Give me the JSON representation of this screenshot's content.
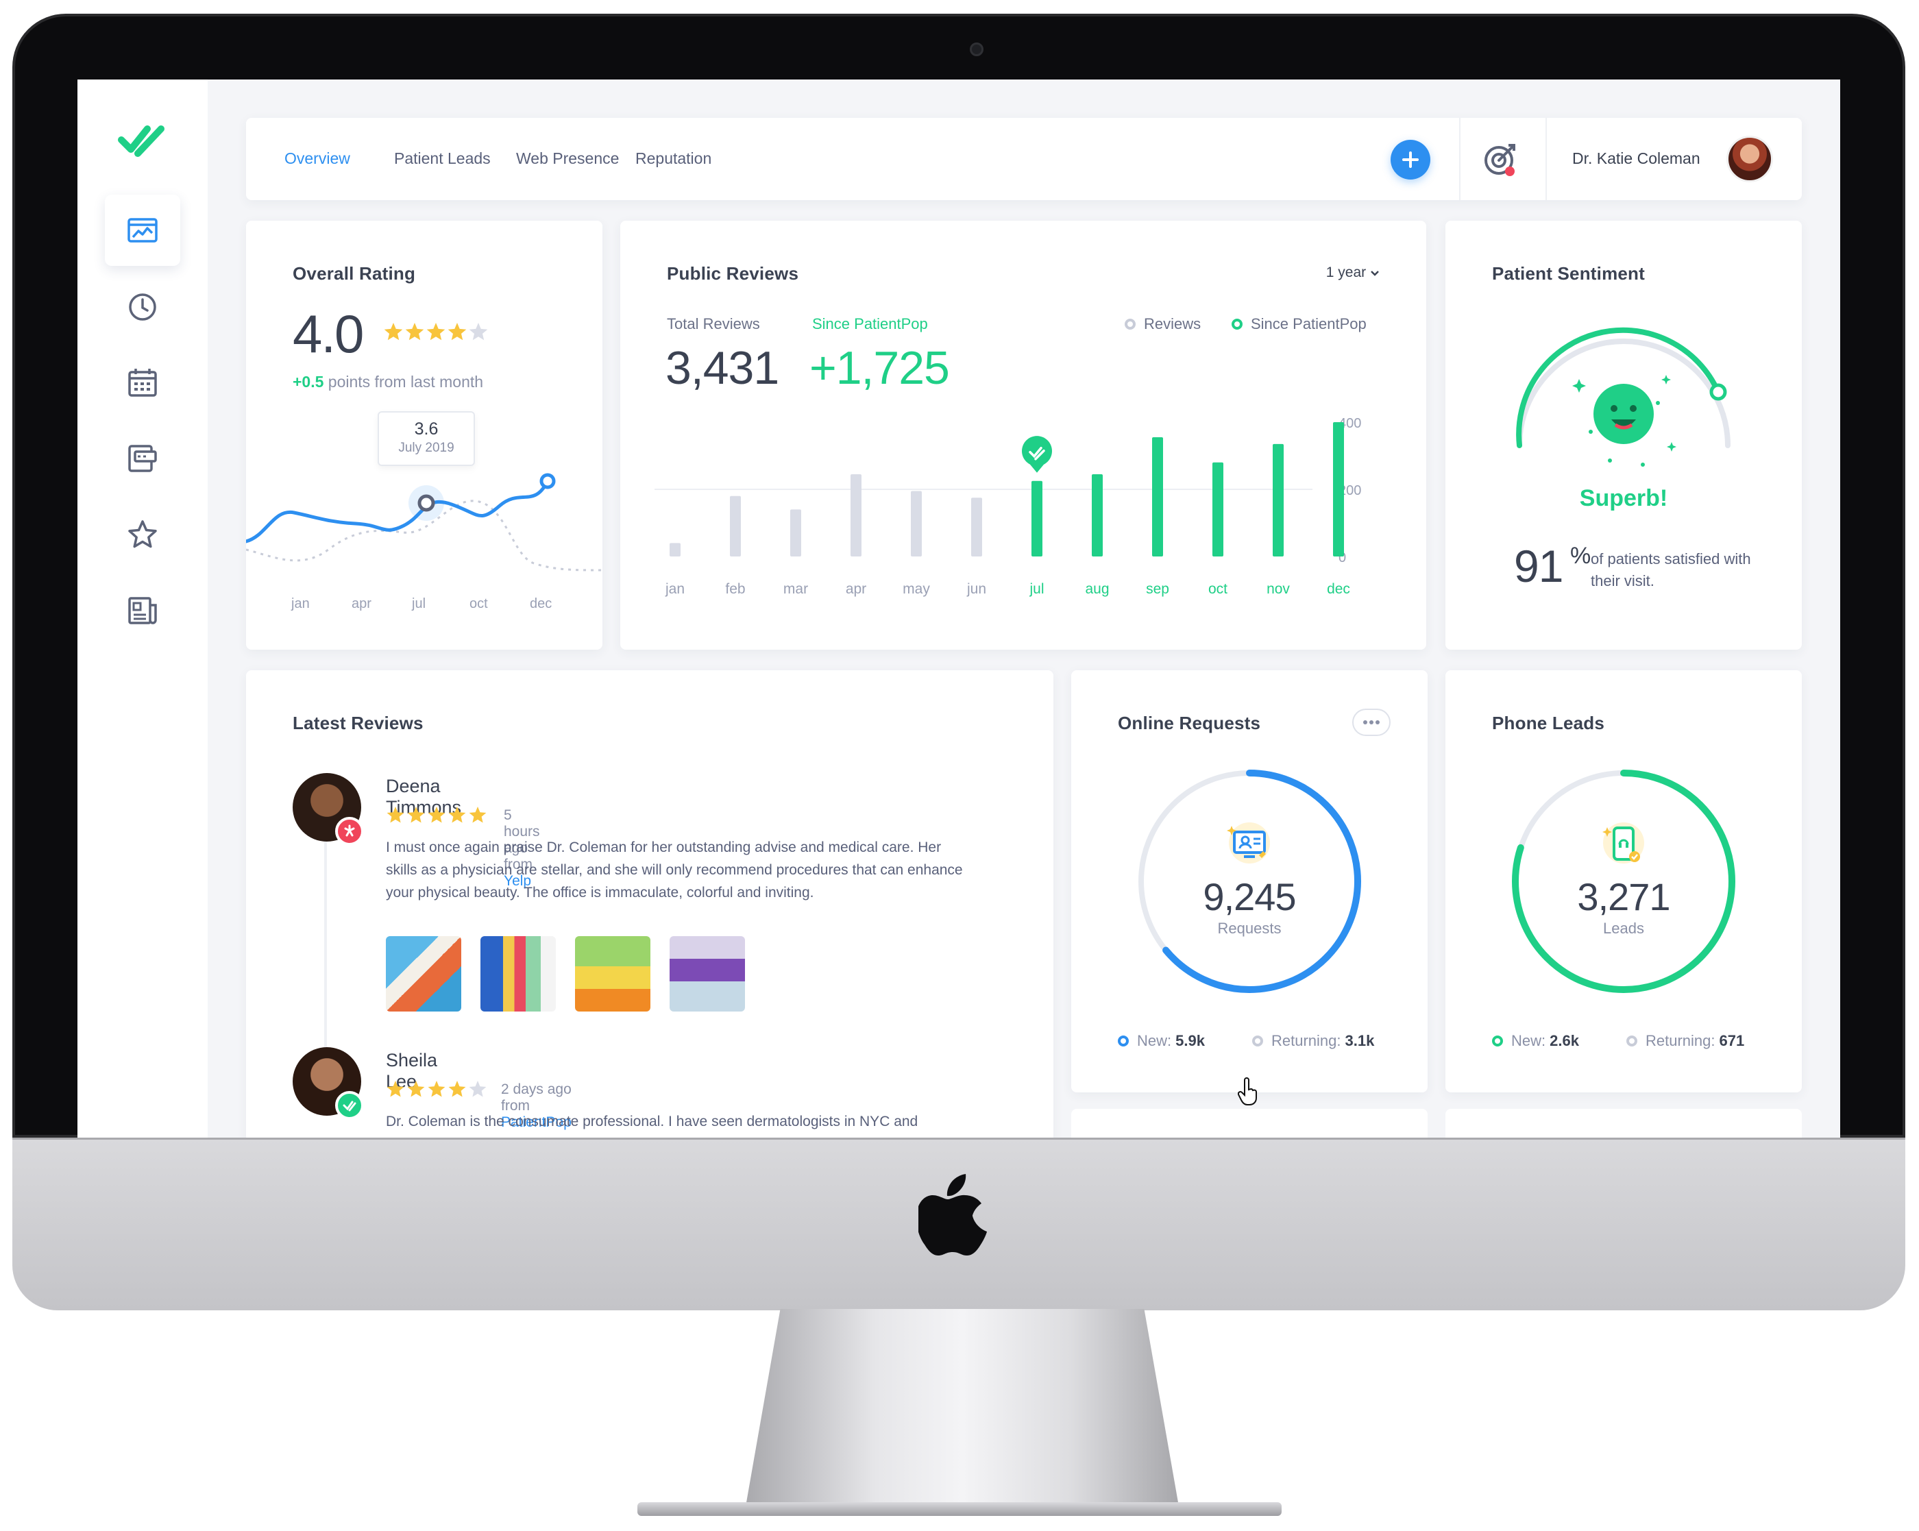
{
  "nav": {
    "tabs": [
      "Overview",
      "Patient Leads",
      "Web Presence",
      "Reputation"
    ],
    "active_tab": "Overview",
    "user_name": "Dr. Katie Coleman"
  },
  "sidebar": {
    "items": [
      "dashboard-icon",
      "clock-icon",
      "calendar-icon",
      "billing-icon",
      "star-icon",
      "news-icon"
    ],
    "active": "dashboard-icon"
  },
  "overall_rating": {
    "title": "Overall Rating",
    "value": "4.0",
    "stars": 4,
    "delta": "+0.5",
    "delta_text": "points from last month",
    "tooltip_value": "3.6",
    "tooltip_date": "July 2019",
    "months": [
      "jan",
      "apr",
      "jul",
      "oct",
      "dec"
    ]
  },
  "public_reviews": {
    "title": "Public Reviews",
    "period": "1 year",
    "total_label": "Total Reviews",
    "total_value": "3,431",
    "since_label": "Since PatientPop",
    "since_value": "+1,725",
    "legend_reviews": "Reviews",
    "legend_since": "Since PatientPop"
  },
  "chart_data": {
    "type": "bar",
    "categories": [
      "jan",
      "feb",
      "mar",
      "apr",
      "may",
      "jun",
      "jul",
      "aug",
      "sep",
      "oct",
      "nov",
      "dec"
    ],
    "series": [
      {
        "name": "Reviews",
        "values": [
          40,
          180,
          140,
          245,
          195,
          175,
          null,
          null,
          null,
          null,
          null,
          null
        ]
      },
      {
        "name": "Since PatientPop",
        "values": [
          null,
          null,
          null,
          null,
          null,
          null,
          225,
          245,
          355,
          280,
          335,
          400
        ]
      }
    ],
    "yticks": [
      0,
      200,
      400
    ],
    "ylim": [
      0,
      400
    ],
    "colors": {
      "Reviews": "#d9dce6",
      "Since PatientPop": "#1fcf87"
    }
  },
  "patient_sentiment": {
    "title": "Patient Sentiment",
    "label": "Superb!",
    "percent": "91",
    "percent_sign": "%",
    "text": "of patients satisfied with their visit."
  },
  "latest_reviews": {
    "title": "Latest Reviews",
    "items": [
      {
        "name": "Deena Timmons",
        "stars": 5,
        "time": "5 hours ago from",
        "source": "Yelp",
        "text": "I must once again praise Dr. Coleman for her outstanding advise and medical care. Her skills as a physician are stellar, and she will only recommend procedures that can enhance your physical beauty. The office is immaculate, colorful and inviting."
      },
      {
        "name": "Sheila Lee",
        "stars": 4,
        "time": "2 days ago from",
        "source": "PatientPop",
        "text": "Dr. Coleman is the consumate professional. I have seen dermatologists in NYC and"
      }
    ]
  },
  "online_requests": {
    "title": "Online Requests",
    "value": "9,245",
    "unit": "Requests",
    "new_label": "New:",
    "new_value": "5.9k",
    "returning_label": "Returning:",
    "returning_value": "3.1k",
    "fill": 0.64,
    "color": "#2d8ff0"
  },
  "phone_leads": {
    "title": "Phone Leads",
    "value": "3,271",
    "unit": "Leads",
    "new_label": "New:",
    "new_value": "2.6k",
    "returning_label": "Returning:",
    "returning_value": "671",
    "fill": 0.8,
    "color": "#1fcf87"
  },
  "colors": {
    "accent_blue": "#2d8ff0",
    "accent_green": "#1fcf87",
    "text_dark": "#3b4252",
    "star_yellow": "#f8c43c"
  }
}
